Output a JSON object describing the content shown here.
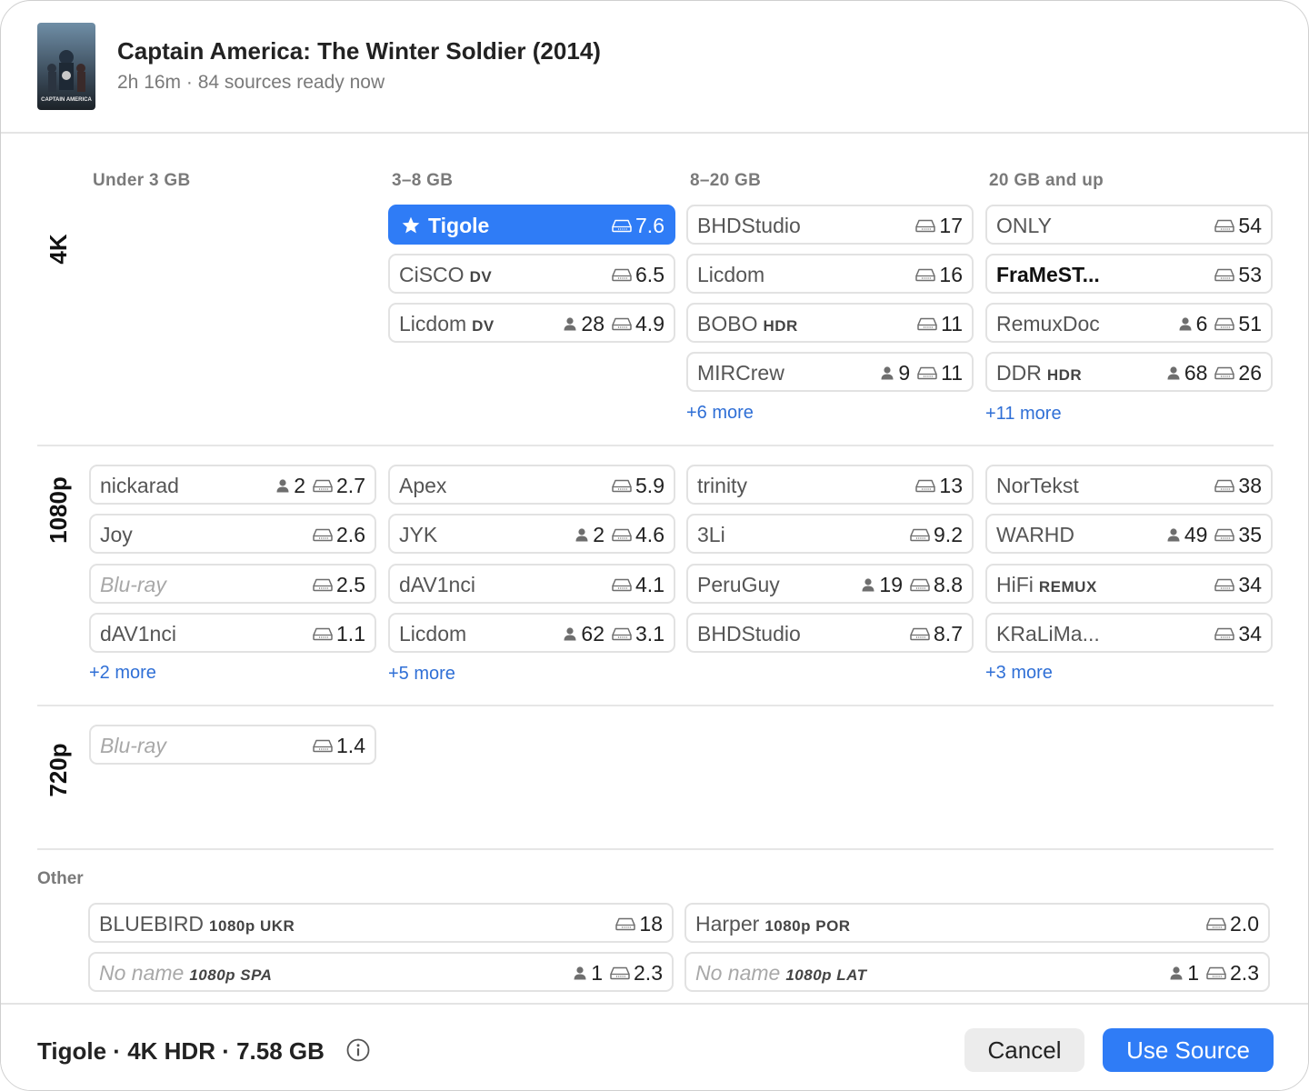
{
  "header": {
    "title": "Captain America: The Winter Soldier (2014)",
    "subtitle": "2h 16m · 84 sources ready now",
    "poster_caption": "CAPTAIN AMERICA"
  },
  "columns": [
    "Under 3 GB",
    "3–8 GB",
    "8–20 GB",
    "20 GB and up"
  ],
  "rows": [
    "4K",
    "1080p",
    "720p"
  ],
  "cards": [
    {
      "name": "Tigole",
      "tag": "",
      "seeders": "",
      "size": "7.6",
      "style": "selected"
    },
    {
      "name": "BHDStudio",
      "tag": "",
      "seeders": "",
      "size": "17",
      "style": ""
    },
    {
      "name": "ONLY",
      "tag": "",
      "seeders": "",
      "size": "54",
      "style": ""
    },
    {
      "name": "CiSCO",
      "tag": "DV",
      "seeders": "",
      "size": "6.5",
      "style": ""
    },
    {
      "name": "Licdom",
      "tag": "",
      "seeders": "",
      "size": "16",
      "style": ""
    },
    {
      "name": "FraMeST...",
      "tag": "",
      "seeders": "",
      "size": "53",
      "style": "bold"
    },
    {
      "name": "Licdom",
      "tag": "DV",
      "seeders": "28",
      "size": "4.9",
      "style": ""
    },
    {
      "name": "BOBO",
      "tag": "HDR",
      "seeders": "",
      "size": "11",
      "style": ""
    },
    {
      "name": "RemuxDoc",
      "tag": "",
      "seeders": "6",
      "size": "51",
      "style": ""
    },
    {
      "name": "MIRCrew",
      "tag": "",
      "seeders": "9",
      "size": "11",
      "style": ""
    },
    {
      "name": "DDR",
      "tag": "HDR",
      "seeders": "68",
      "size": "26",
      "style": ""
    },
    {
      "name": "nickarad",
      "tag": "",
      "seeders": "2",
      "size": "2.7",
      "style": ""
    },
    {
      "name": "Apex",
      "tag": "",
      "seeders": "",
      "size": "5.9",
      "style": ""
    },
    {
      "name": "trinity",
      "tag": "",
      "seeders": "",
      "size": "13",
      "style": ""
    },
    {
      "name": "NorTekst",
      "tag": "",
      "seeders": "",
      "size": "38",
      "style": ""
    },
    {
      "name": "Joy",
      "tag": "",
      "seeders": "",
      "size": "2.6",
      "style": ""
    },
    {
      "name": "JYK",
      "tag": "",
      "seeders": "2",
      "size": "4.6",
      "style": ""
    },
    {
      "name": "3Li",
      "tag": "",
      "seeders": "",
      "size": "9.2",
      "style": ""
    },
    {
      "name": "WARHD",
      "tag": "",
      "seeders": "49",
      "size": "35",
      "style": ""
    },
    {
      "name": "Blu-ray",
      "tag": "",
      "seeders": "",
      "size": "2.5",
      "style": "italic"
    },
    {
      "name": "dAV1nci",
      "tag": "",
      "seeders": "",
      "size": "4.1",
      "style": ""
    },
    {
      "name": "PeruGuy",
      "tag": "",
      "seeders": "19",
      "size": "8.8",
      "style": ""
    },
    {
      "name": "HiFi",
      "tag": "REMUX",
      "seeders": "",
      "size": "34",
      "style": ""
    },
    {
      "name": "dAV1nci",
      "tag": "",
      "seeders": "",
      "size": "1.1",
      "style": ""
    },
    {
      "name": "Licdom",
      "tag": "",
      "seeders": "62",
      "size": "3.1",
      "style": ""
    },
    {
      "name": "BHDStudio",
      "tag": "",
      "seeders": "",
      "size": "8.7",
      "style": ""
    },
    {
      "name": "KRaLiMa...",
      "tag": "",
      "seeders": "",
      "size": "34",
      "style": ""
    },
    {
      "name": "Blu-ray",
      "tag": "",
      "seeders": "",
      "size": "1.4",
      "style": "italic"
    },
    {
      "name": "BLUEBIRD",
      "tag": "1080p UKR",
      "seeders": "",
      "size": "18",
      "style": ""
    },
    {
      "name": "Harper",
      "tag": "1080p POR",
      "seeders": "",
      "size": "2.0",
      "style": ""
    },
    {
      "name": "No name",
      "tag": "1080p SPA",
      "seeders": "1",
      "size": "2.3",
      "style": "italic"
    },
    {
      "name": "No name",
      "tag": "1080p LAT",
      "seeders": "1",
      "size": "2.3",
      "style": "italic"
    }
  ],
  "more_links": [
    "+6 more",
    "+11 more",
    "+2 more",
    "+5 more",
    "+3 more"
  ],
  "other_label": "Other",
  "footer": {
    "summary": "Tigole · 4K HDR · 7.58 GB",
    "cancel_label": "Cancel",
    "use_label": "Use Source"
  },
  "colors": {
    "accent": "#2f7cf6",
    "link": "#2f6fd6"
  },
  "icons": {
    "drive": "drive-icon",
    "seeders": "person-icon",
    "favorite": "star-icon",
    "info": "info-icon"
  }
}
